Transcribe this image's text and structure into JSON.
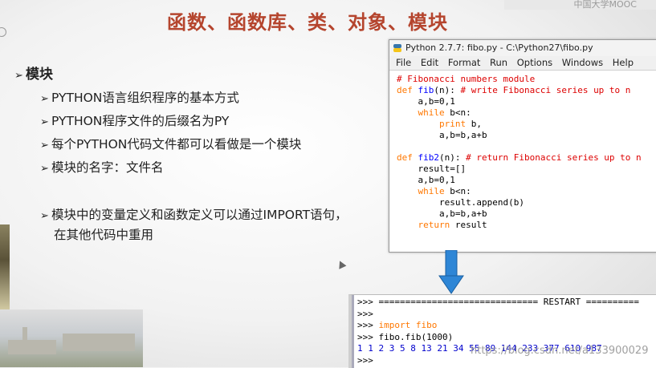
{
  "slide": {
    "title": "函数、函数库、类、对象、模块",
    "corner_text": "中国大学MOOC",
    "heading": "模块",
    "points": [
      "PYTHON语言组织程序的基本方式",
      "PYTHON程序文件的后缀名为PY",
      "每个PYTHON代码文件都可以看做是一个模块",
      "模块的名字：文件名"
    ],
    "point_long_line1": "模块中的变量定义和函数定义可以通过IMPORT语句，",
    "point_long_line2": "在其他代码中重用"
  },
  "editor": {
    "title": "Python 2.7.7: fibo.py - C:\\Python27\\fibo.py",
    "menu": [
      "File",
      "Edit",
      "Format",
      "Run",
      "Options",
      "Windows",
      "Help"
    ]
  },
  "shell": {
    "restart": ">>> ============================== RESTART ==========",
    "p1": ">>>",
    "p2": ">>>",
    "import": "import fibo",
    "call": "fibo.fib(1000)",
    "output": "1 1 2 3 5 8 13 21 34 55 89 144 233 377 610 987",
    "p_last": ">>>"
  },
  "watermark": "https://blog.csdn.net/a133900029",
  "colors": {
    "title": "#b5452e",
    "arrow": "#2e86d6",
    "comment": "#dd0000",
    "keyword": "#ff7700",
    "funcname": "#0000ff"
  }
}
